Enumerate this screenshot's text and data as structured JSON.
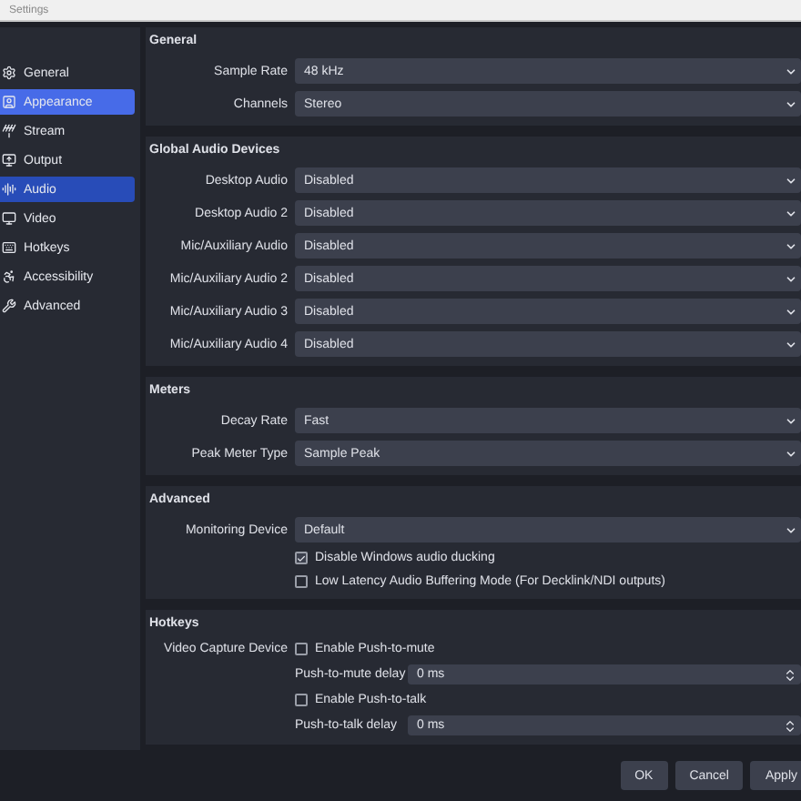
{
  "window": {
    "title": "Settings"
  },
  "sidebar": {
    "items": [
      {
        "label": "General",
        "selected": false,
        "hovered": false
      },
      {
        "label": "Appearance",
        "selected": false,
        "hovered": true
      },
      {
        "label": "Stream",
        "selected": false,
        "hovered": false
      },
      {
        "label": "Output",
        "selected": false,
        "hovered": false
      },
      {
        "label": "Audio",
        "selected": true,
        "hovered": false
      },
      {
        "label": "Video",
        "selected": false,
        "hovered": false
      },
      {
        "label": "Hotkeys",
        "selected": false,
        "hovered": false
      },
      {
        "label": "Accessibility",
        "selected": false,
        "hovered": false
      },
      {
        "label": "Advanced",
        "selected": false,
        "hovered": false
      }
    ]
  },
  "sections": [
    {
      "title": "General",
      "rows": [
        {
          "kind": "select",
          "label": "Sample Rate",
          "value": "48 kHz"
        },
        {
          "kind": "select",
          "label": "Channels",
          "value": "Stereo"
        }
      ]
    },
    {
      "title": "Global Audio Devices",
      "rows": [
        {
          "kind": "select",
          "label": "Desktop Audio",
          "value": "Disabled"
        },
        {
          "kind": "select",
          "label": "Desktop Audio 2",
          "value": "Disabled"
        },
        {
          "kind": "select",
          "label": "Mic/Auxiliary Audio",
          "value": "Disabled"
        },
        {
          "kind": "select",
          "label": "Mic/Auxiliary Audio 2",
          "value": "Disabled"
        },
        {
          "kind": "select",
          "label": "Mic/Auxiliary Audio 3",
          "value": "Disabled"
        },
        {
          "kind": "select",
          "label": "Mic/Auxiliary Audio 4",
          "value": "Disabled"
        }
      ]
    },
    {
      "title": "Meters",
      "rows": [
        {
          "kind": "select",
          "label": "Decay Rate",
          "value": "Fast"
        },
        {
          "kind": "select",
          "label": "Peak Meter Type",
          "value": "Sample Peak"
        }
      ]
    },
    {
      "title": "Advanced",
      "rows": [
        {
          "kind": "select",
          "label": "Monitoring Device",
          "value": "Default"
        },
        {
          "kind": "checkbox",
          "text": "Disable Windows audio ducking",
          "checked": true
        },
        {
          "kind": "checkbox",
          "text": "Low Latency Audio Buffering Mode (For Decklink/NDI outputs)",
          "checked": false
        }
      ]
    },
    {
      "title": "Hotkeys",
      "rows": [
        {
          "kind": "checkbox",
          "label": "Video Capture Device",
          "text": "Enable Push-to-mute",
          "checked": false
        },
        {
          "kind": "spin",
          "text": "Push-to-mute delay",
          "value": "0 ms"
        },
        {
          "kind": "checkbox",
          "text": "Enable Push-to-talk",
          "checked": false
        },
        {
          "kind": "spin",
          "text": "Push-to-talk delay",
          "value": "0 ms"
        }
      ]
    }
  ],
  "buttons": [
    "OK",
    "Cancel",
    "Apply"
  ]
}
